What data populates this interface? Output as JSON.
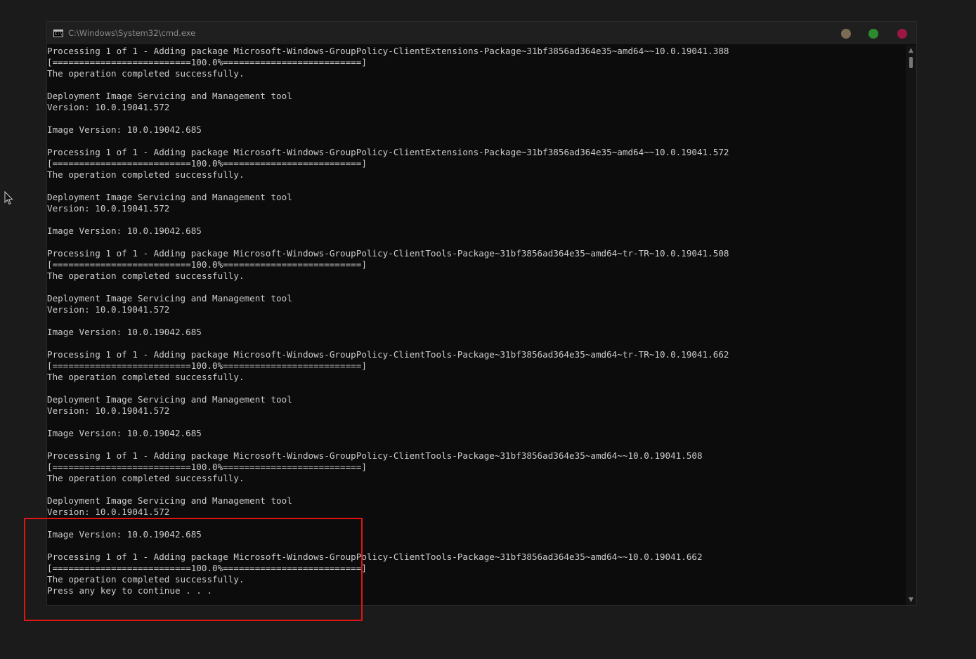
{
  "window": {
    "title": "C:\\Windows\\System32\\cmd.exe",
    "icon_text": "C:\\",
    "buttons": {
      "minimize_color": "#7d6c55",
      "maximize_color": "#2e8a2e",
      "close_color": "#9c1746"
    }
  },
  "console": {
    "lines": [
      "Processing 1 of 1 - Adding package Microsoft-Windows-GroupPolicy-ClientExtensions-Package~31bf3856ad364e35~amd64~~10.0.19041.388",
      "[==========================100.0%==========================]",
      "The operation completed successfully.",
      "",
      "Deployment Image Servicing and Management tool",
      "Version: 10.0.19041.572",
      "",
      "Image Version: 10.0.19042.685",
      "",
      "Processing 1 of 1 - Adding package Microsoft-Windows-GroupPolicy-ClientExtensions-Package~31bf3856ad364e35~amd64~~10.0.19041.572",
      "[==========================100.0%==========================]",
      "The operation completed successfully.",
      "",
      "Deployment Image Servicing and Management tool",
      "Version: 10.0.19041.572",
      "",
      "Image Version: 10.0.19042.685",
      "",
      "Processing 1 of 1 - Adding package Microsoft-Windows-GroupPolicy-ClientTools-Package~31bf3856ad364e35~amd64~tr-TR~10.0.19041.508",
      "[==========================100.0%==========================]",
      "The operation completed successfully.",
      "",
      "Deployment Image Servicing and Management tool",
      "Version: 10.0.19041.572",
      "",
      "Image Version: 10.0.19042.685",
      "",
      "Processing 1 of 1 - Adding package Microsoft-Windows-GroupPolicy-ClientTools-Package~31bf3856ad364e35~amd64~tr-TR~10.0.19041.662",
      "[==========================100.0%==========================]",
      "The operation completed successfully.",
      "",
      "Deployment Image Servicing and Management tool",
      "Version: 10.0.19041.572",
      "",
      "Image Version: 10.0.19042.685",
      "",
      "Processing 1 of 1 - Adding package Microsoft-Windows-GroupPolicy-ClientTools-Package~31bf3856ad364e35~amd64~~10.0.19041.508",
      "[==========================100.0%==========================]",
      "The operation completed successfully.",
      "",
      "Deployment Image Servicing and Management tool",
      "Version: 10.0.19041.572",
      "",
      "Image Version: 10.0.19042.685",
      "",
      "Processing 1 of 1 - Adding package Microsoft-Windows-GroupPolicy-ClientTools-Package~31bf3856ad364e35~amd64~~10.0.19041.662",
      "[==========================100.0%==========================]",
      "The operation completed successfully.",
      "Press any key to continue . . ."
    ]
  },
  "scrollbar": {
    "up_icon": "chevron-up-icon",
    "down_icon": "chevron-down-icon"
  },
  "annotation": {
    "highlight_color": "#e01414"
  }
}
